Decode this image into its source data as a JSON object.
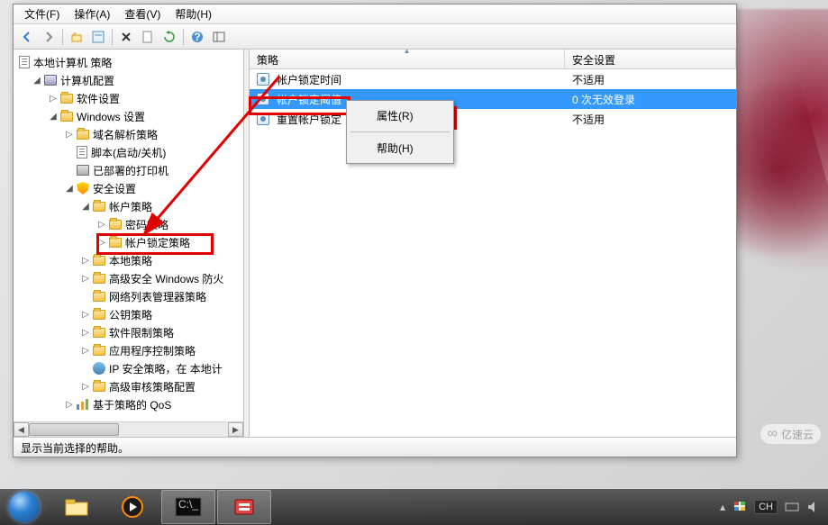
{
  "menubar": {
    "file": "文件(F)",
    "action": "操作(A)",
    "view": "查看(V)",
    "help": "帮助(H)"
  },
  "tree": {
    "root": "本地计算机 策略",
    "computer_config": "计算机配置",
    "software_settings": "软件设置",
    "windows_settings": "Windows 设置",
    "name_resolution": "域名解析策略",
    "scripts": "脚本(启动/关机)",
    "deployed_printers": "已部署的打印机",
    "security_settings": "安全设置",
    "account_policies": "帐户策略",
    "password_policy": "密码策略",
    "lockout_policy": "帐户锁定策略",
    "local_policies": "本地策略",
    "windows_firewall": "高级安全 Windows 防火",
    "nlm": "网络列表管理器策略",
    "public_key": "公钥策略",
    "software_restriction": "软件限制策略",
    "app_control": "应用程序控制策略",
    "ip_security": "IP 安全策略，在 本地计",
    "audit_config": "高级审核策略配置",
    "qos": "基于策略的 QoS"
  },
  "columns": {
    "policy": "策略",
    "security_setting": "安全设置"
  },
  "rows": [
    {
      "name": "帐户锁定时间",
      "value": "不适用"
    },
    {
      "name": "帐户锁定阈值",
      "value": "0 次无效登录"
    },
    {
      "name": "重置帐户锁定",
      "value": "不适用"
    }
  ],
  "context_menu": {
    "properties": "属性(R)",
    "help": "帮助(H)"
  },
  "statusbar": "显示当前选择的帮助。",
  "watermark": "亿速云",
  "taskbar": {
    "lang": "CH"
  }
}
